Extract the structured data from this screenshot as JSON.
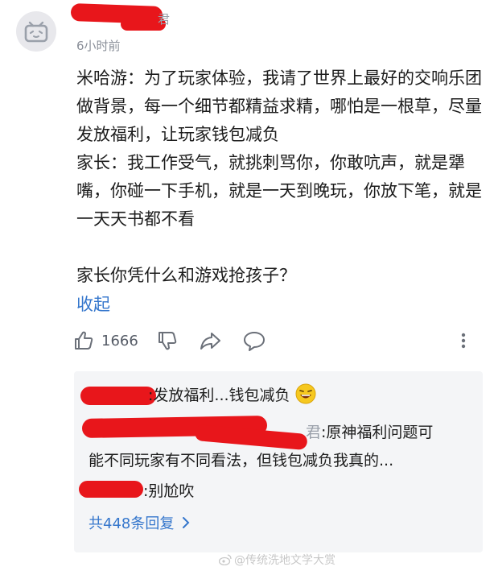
{
  "comment": {
    "username_tail": "君",
    "time": "6小时前",
    "paragraphs": [
      "米哈游：为了玩家体验，我请了世界上最好的交响乐团做背景，每一个细节都精益求精，哪怕是一根草，尽量发放福利，让玩家钱包减负",
      "家长：我工作受气，就挑刺骂你，你敢吭声，就是犟嘴，你碰一下手机，就是一天到晚玩，你放下笔，就是一天天书都不看",
      "家长你凭什么和游戏抢孩子？"
    ],
    "collapse_label": "收起",
    "like_count": "1666"
  },
  "replies": {
    "items": [
      {
        "text": ":发放福利...钱包减负"
      },
      {
        "prefix": "君",
        "line1": ":原神福利问题可",
        "line2": "能不同玩家有不同看法，但钱包减负我真的..."
      },
      {
        "text": ":别尬吹"
      }
    ],
    "more_label": "共448条回复"
  },
  "watermark": "@传统洗地文学大赏",
  "icons": {
    "avatar": "bilibili-tv-avatar-icon",
    "like": "thumbs-up-icon",
    "dislike": "thumbs-down-icon",
    "share": "share-arrow-icon",
    "comment": "comment-bubble-icon",
    "more": "more-vertical-icon",
    "emoji": "grinning-face-emoji-icon",
    "chevron": "chevron-right-icon"
  },
  "colors": {
    "link": "#3476cc",
    "redaction": "#e8161b",
    "reply_bg": "#f4f5f7"
  }
}
